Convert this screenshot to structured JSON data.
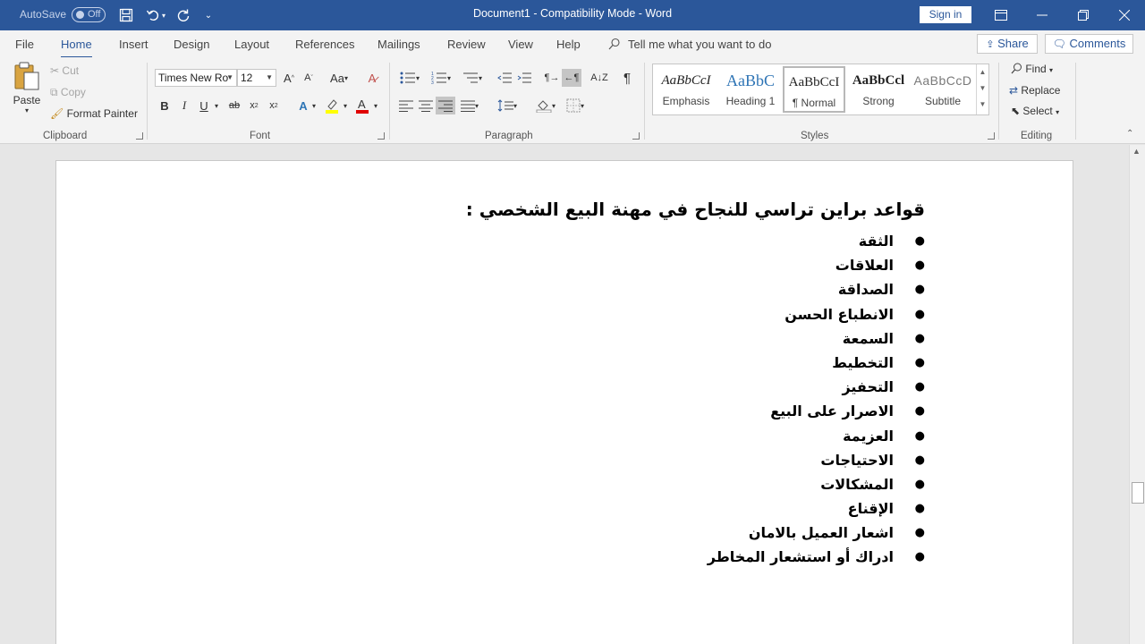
{
  "titlebar": {
    "autosave_label": "AutoSave",
    "autosave_state": "Off",
    "title": "Document1  -  Compatibility Mode  -  Word",
    "signin": "Sign in"
  },
  "tabs": {
    "file": "File",
    "home": "Home",
    "insert": "Insert",
    "design": "Design",
    "layout": "Layout",
    "references": "References",
    "mailings": "Mailings",
    "review": "Review",
    "view": "View",
    "help": "Help",
    "tell_me": "Tell me what you want to do",
    "share": "Share",
    "comments": "Comments"
  },
  "clipboard": {
    "paste": "Paste",
    "cut": "Cut",
    "copy": "Copy",
    "format_painter": "Format Painter",
    "label": "Clipboard"
  },
  "font": {
    "name": "Times New Ro",
    "size": "12",
    "case_btn": "Aa",
    "bold": "B",
    "italic": "I",
    "underline": "U",
    "strike": "ab",
    "label": "Font"
  },
  "paragraph": {
    "label": "Paragraph"
  },
  "styles": {
    "items": [
      {
        "preview": "AaBbCcI",
        "name": "Emphasis"
      },
      {
        "preview": "AaBbC",
        "name": "Heading 1"
      },
      {
        "preview": "AaBbCcI",
        "name": "¶ Normal"
      },
      {
        "preview": "AaBbCcl",
        "name": "Strong"
      },
      {
        "preview": "AaBbCcD",
        "name": "Subtitle"
      }
    ],
    "label": "Styles"
  },
  "editing": {
    "find": "Find",
    "replace": "Replace",
    "select": "Select",
    "label": "Editing"
  },
  "document": {
    "heading": "قواعد براين تراسي للنجاح في مهنة البيع الشخصي :",
    "items": [
      "الثقة",
      "العلاقات",
      "الصداقة",
      "الانطباع الحسن",
      "السمعة",
      "التخطيط",
      "التحفيز",
      "الاصرار على البيع",
      "العزيمة",
      "الاحتياجات",
      "المشكالات",
      "الإقناع",
      "اشعار العميل بالامان",
      "ادراك أو استشعار المخاطر"
    ]
  }
}
